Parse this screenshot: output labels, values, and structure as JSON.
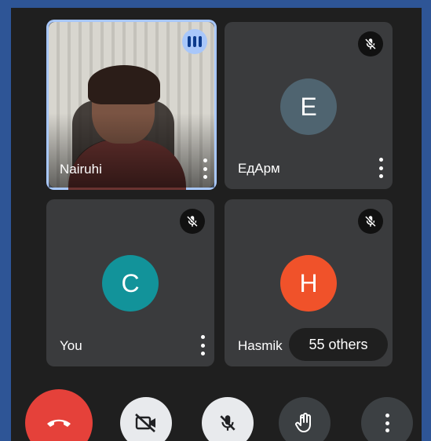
{
  "participants": [
    {
      "name": "Nairuhi",
      "state": "speaking",
      "video": true
    },
    {
      "name": "ЕдАрм",
      "initial": "E",
      "avatar_color": "#4f6470",
      "state": "muted"
    },
    {
      "name": "You",
      "initial": "C",
      "avatar_color": "#12939a",
      "state": "muted"
    },
    {
      "name": "Hasmik",
      "initial": "H",
      "avatar_color": "#f0522a",
      "state": "muted"
    }
  ],
  "others_label": "55 others",
  "controls": {
    "end_call": "end-call",
    "camera": "camera-off",
    "microphone": "microphone-off",
    "raise_hand": "raise-hand",
    "more": "more-options"
  },
  "colors": {
    "end_call": "#e5413a",
    "speaking_ring": "#a8c7fa",
    "tile_bg": "#3a3b3d"
  }
}
